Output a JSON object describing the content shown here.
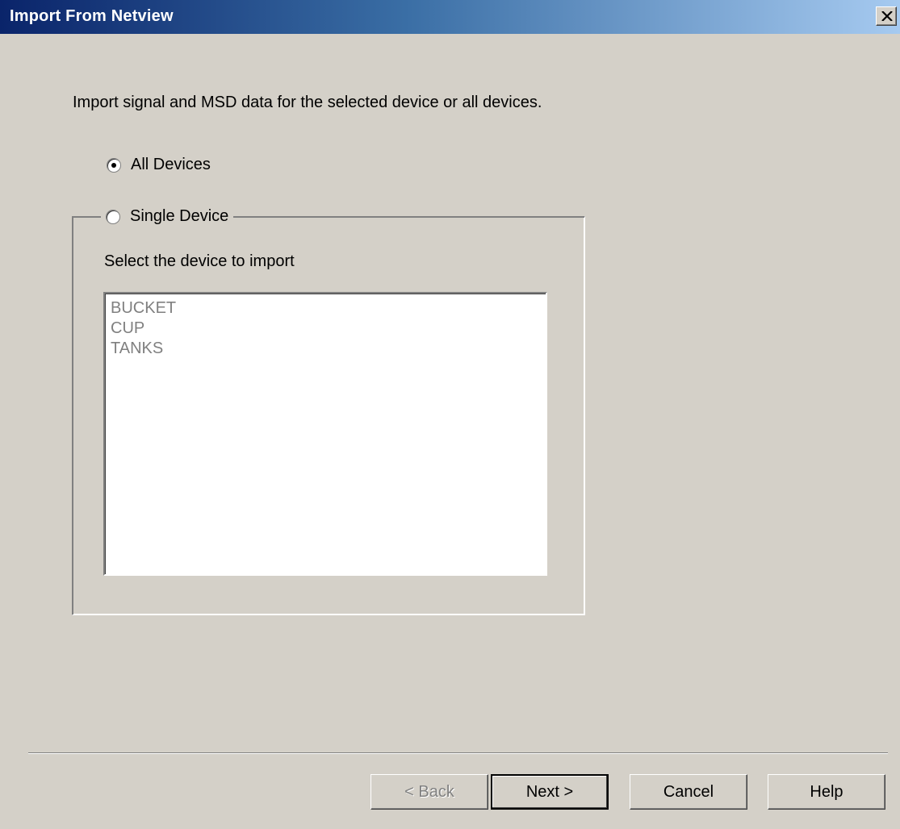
{
  "window": {
    "title": "Import From Netview",
    "close_glyph": "close-icon"
  },
  "intro_text": "Import signal and MSD data for the selected device or all devices.",
  "options": {
    "all_devices": {
      "label": "All Devices",
      "selected": true
    },
    "single_device": {
      "label": "Single Device",
      "selected": false
    }
  },
  "device_section": {
    "prompt": "Select the device to import",
    "devices": [
      "BUCKET",
      "CUP",
      "TANKS"
    ]
  },
  "buttons": {
    "back": "< Back",
    "next": "Next >",
    "cancel": "Cancel",
    "help": "Help"
  },
  "colors": {
    "titlebar_start": "#0a246a",
    "titlebar_end": "#a6caf0",
    "face": "#d4d0c8",
    "disabled_text": "#808080"
  }
}
